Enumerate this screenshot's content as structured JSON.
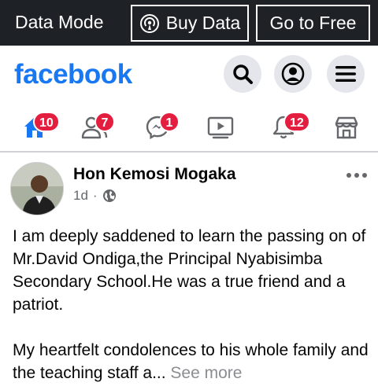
{
  "data_bar": {
    "mode_label": "Data Mode",
    "buy_label": "Buy Data",
    "free_label": "Go to Free"
  },
  "header": {
    "logo": "facebook",
    "search_icon": "search-icon",
    "profile_icon": "profile-icon",
    "menu_icon": "menu-icon"
  },
  "nav": {
    "home_badge": "10",
    "friends_badge": "7",
    "messenger_badge": "1",
    "notifications_badge": "12"
  },
  "post": {
    "author": "Hon Kemosi Mogaka",
    "time": "1d",
    "separator": "·",
    "paragraph1": "I am deeply saddened to learn the passing on of Mr.David Ondiga,the Principal Nyabisimba Secondary School.He was a true friend and a patriot.",
    "paragraph2": "My heartfelt condolences to his whole family and the teaching staff a...",
    "see_more": "See more"
  },
  "colors": {
    "brand": "#1877f2",
    "badge": "#e41e3f",
    "data_bar_bg": "#1e2125"
  }
}
